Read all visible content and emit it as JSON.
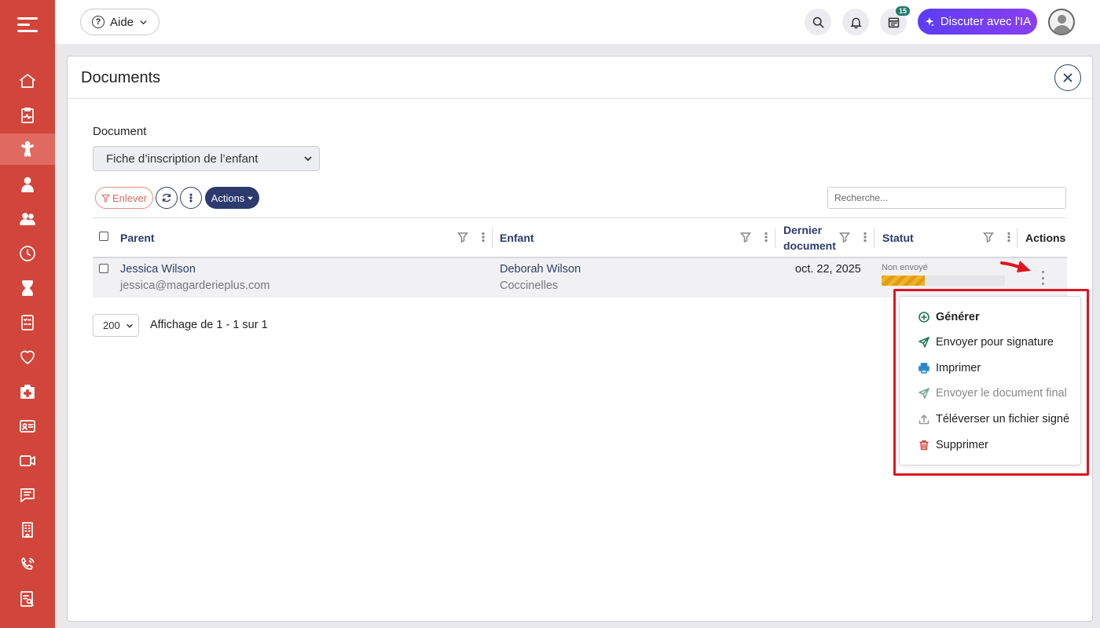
{
  "topbar": {
    "help_label": "Aide",
    "notif_badge": "15",
    "ia_label": "Discuter avec l'IA"
  },
  "modal": {
    "title": "Documents",
    "document_label": "Document",
    "document_selected": "Fiche d’inscription de l’enfant",
    "remove_label": "Enlever",
    "actions_label": "Actions",
    "search_placeholder": "Recherche..."
  },
  "table": {
    "columns": {
      "parent": "Parent",
      "enfant": "Enfant",
      "dernier_doc_1": "Dernier",
      "dernier_doc_2": "document",
      "statut": "Statut",
      "actions": "Actions"
    },
    "rows": [
      {
        "parent_name": "Jessica Wilson",
        "parent_email": "jessica@magarderieplus.com",
        "child_name": "Deborah Wilson",
        "child_group": "Coccinelles",
        "last_document": "oct. 22, 2025",
        "status": "Non envoyé",
        "status_progress": 0.35
      }
    ]
  },
  "pagination": {
    "page_size": "200",
    "info": "Affichage de 1 - 1 sur 1"
  },
  "menu": {
    "items": [
      {
        "label": "Générer",
        "icon": "plus-circle-icon"
      },
      {
        "label": "Envoyer pour signature",
        "icon": "send-icon"
      },
      {
        "label": "Imprimer",
        "icon": "printer-icon"
      },
      {
        "label": "Envoyer le document final",
        "icon": "send-icon"
      },
      {
        "label": "Téléverser un fichier signé",
        "icon": "upload-icon"
      },
      {
        "label": "Supprimer",
        "icon": "trash-icon"
      }
    ]
  },
  "colors": {
    "sidebar": "#d1453a",
    "primary": "#2c3a6e",
    "highlight": "#e0141e"
  }
}
